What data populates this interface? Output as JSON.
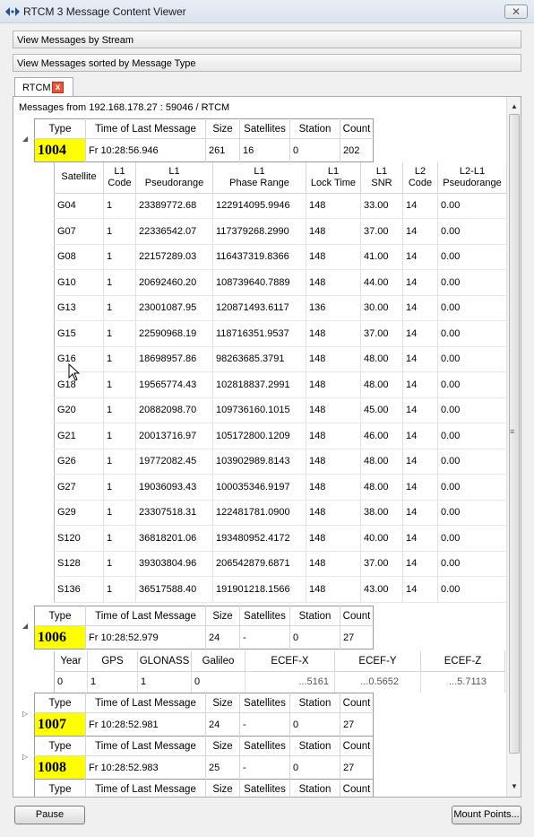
{
  "window": {
    "title": "RTCM 3 Message Content Viewer",
    "close_label": "✕"
  },
  "bars": {
    "by_stream": "View Messages by Stream",
    "by_type": "View Messages sorted by Message Type"
  },
  "tab": {
    "label": "RTCM",
    "close_label": "x"
  },
  "panel": {
    "header": "Messages from 192.168.178.27 : 59046 / RTCM"
  },
  "message_columns": [
    "Type",
    "Time of Last Message",
    "Size",
    "Satellites",
    "Station",
    "Count"
  ],
  "messages": [
    {
      "type": "1004",
      "time": "Fr 10:28:56.946",
      "size": "261",
      "satellites": "16",
      "station": "0",
      "count": "202"
    },
    {
      "type": "1006",
      "time": "Fr 10:28:52.979",
      "size": "24",
      "satellites": "-",
      "station": "0",
      "count": "27"
    },
    {
      "type": "1007",
      "time": "Fr 10:28:52.981",
      "size": "24",
      "satellites": "-",
      "station": "0",
      "count": "27"
    },
    {
      "type": "1008",
      "time": "Fr 10:28:52.983",
      "size": "25",
      "satellites": "-",
      "station": "0",
      "count": "27"
    },
    {
      "type": "",
      "time": "",
      "size": "",
      "satellites": "",
      "station": "",
      "count": ""
    }
  ],
  "satellite_columns": [
    {
      "l1": "Satellite",
      "l2": ""
    },
    {
      "l1": "L1",
      "l2": "Code"
    },
    {
      "l1": "L1",
      "l2": "Pseudorange"
    },
    {
      "l1": "L1",
      "l2": "Phase Range"
    },
    {
      "l1": "L1",
      "l2": "Lock Time"
    },
    {
      "l1": "L1",
      "l2": "SNR"
    },
    {
      "l1": "L2",
      "l2": "Code"
    },
    {
      "l1": "L2-L1",
      "l2": "Pseudorange"
    }
  ],
  "satellites": [
    [
      "G04",
      "1",
      "23389772.68",
      "122914095.9946",
      "148",
      "33.00",
      "14",
      "0.00"
    ],
    [
      "G07",
      "1",
      "22336542.07",
      "117379268.2990",
      "148",
      "37.00",
      "14",
      "0.00"
    ],
    [
      "G08",
      "1",
      "22157289.03",
      "116437319.8366",
      "148",
      "41.00",
      "14",
      "0.00"
    ],
    [
      "G10",
      "1",
      "20692460.20",
      "108739640.7889",
      "148",
      "44.00",
      "14",
      "0.00"
    ],
    [
      "G13",
      "1",
      "23001087.95",
      "120871493.6117",
      "136",
      "30.00",
      "14",
      "0.00"
    ],
    [
      "G15",
      "1",
      "22590968.19",
      "118716351.9537",
      "148",
      "37.00",
      "14",
      "0.00"
    ],
    [
      "G16",
      "1",
      "18698957.86",
      "98263685.3791",
      "148",
      "48.00",
      "14",
      "0.00"
    ],
    [
      "G18",
      "1",
      "19565774.43",
      "102818837.2991",
      "148",
      "48.00",
      "14",
      "0.00"
    ],
    [
      "G20",
      "1",
      "20882098.70",
      "109736160.1015",
      "148",
      "45.00",
      "14",
      "0.00"
    ],
    [
      "G21",
      "1",
      "20013716.97",
      "105172800.1209",
      "148",
      "46.00",
      "14",
      "0.00"
    ],
    [
      "G26",
      "1",
      "19772082.45",
      "103902989.8143",
      "148",
      "48.00",
      "14",
      "0.00"
    ],
    [
      "G27",
      "1",
      "19036093.43",
      "100035346.9197",
      "148",
      "48.00",
      "14",
      "0.00"
    ],
    [
      "G29",
      "1",
      "23307518.31",
      "122481781.0900",
      "148",
      "38.00",
      "14",
      "0.00"
    ],
    [
      "S120",
      "1",
      "36818201.06",
      "193480952.4172",
      "148",
      "40.00",
      "14",
      "0.00"
    ],
    [
      "S128",
      "1",
      "39303804.96",
      "206542879.6871",
      "148",
      "37.00",
      "14",
      "0.00"
    ],
    [
      "S136",
      "1",
      "36517588.40",
      "191901218.1566",
      "148",
      "43.00",
      "14",
      "0.00"
    ]
  ],
  "station_columns": [
    "Year",
    "GPS",
    "GLONASS",
    "Galileo",
    "ECEF-X",
    "ECEF-Y",
    "ECEF-Z"
  ],
  "station_row": [
    "0",
    "1",
    "1",
    "0",
    "...5161",
    "...0.5652",
    "...5.7113"
  ],
  "buttons": {
    "pause": "Pause",
    "mount_points": "Mount Points..."
  }
}
